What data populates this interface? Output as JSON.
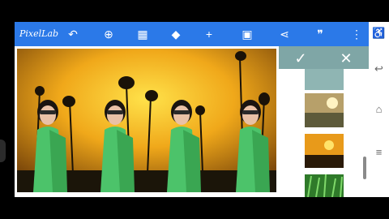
{
  "app": {
    "title": "PixelLab"
  },
  "toolbar": {
    "icons": [
      "undo-icon",
      "zoom-icon",
      "grid-icon",
      "layers-icon",
      "add-icon",
      "save-icon",
      "share-icon",
      "quote-icon",
      "more-icon"
    ],
    "glyphs": [
      "⮌",
      "⊕",
      "▦",
      "◆",
      "+",
      "💾",
      "⋖",
      "❞",
      "⋮"
    ]
  },
  "panel": {
    "confirm": "✓",
    "cancel": "✕",
    "thumbnails": [
      "sky-texture",
      "sunset-field",
      "sunset-silhouette",
      "green-grass"
    ]
  },
  "nav": {
    "accessibility": "♿",
    "back": "↩",
    "home": "⌂",
    "menu": "≡"
  },
  "colors": {
    "toolbar": "#2b79e8",
    "panel_header": "#7fa6a6",
    "saree": "#4cc36a"
  }
}
